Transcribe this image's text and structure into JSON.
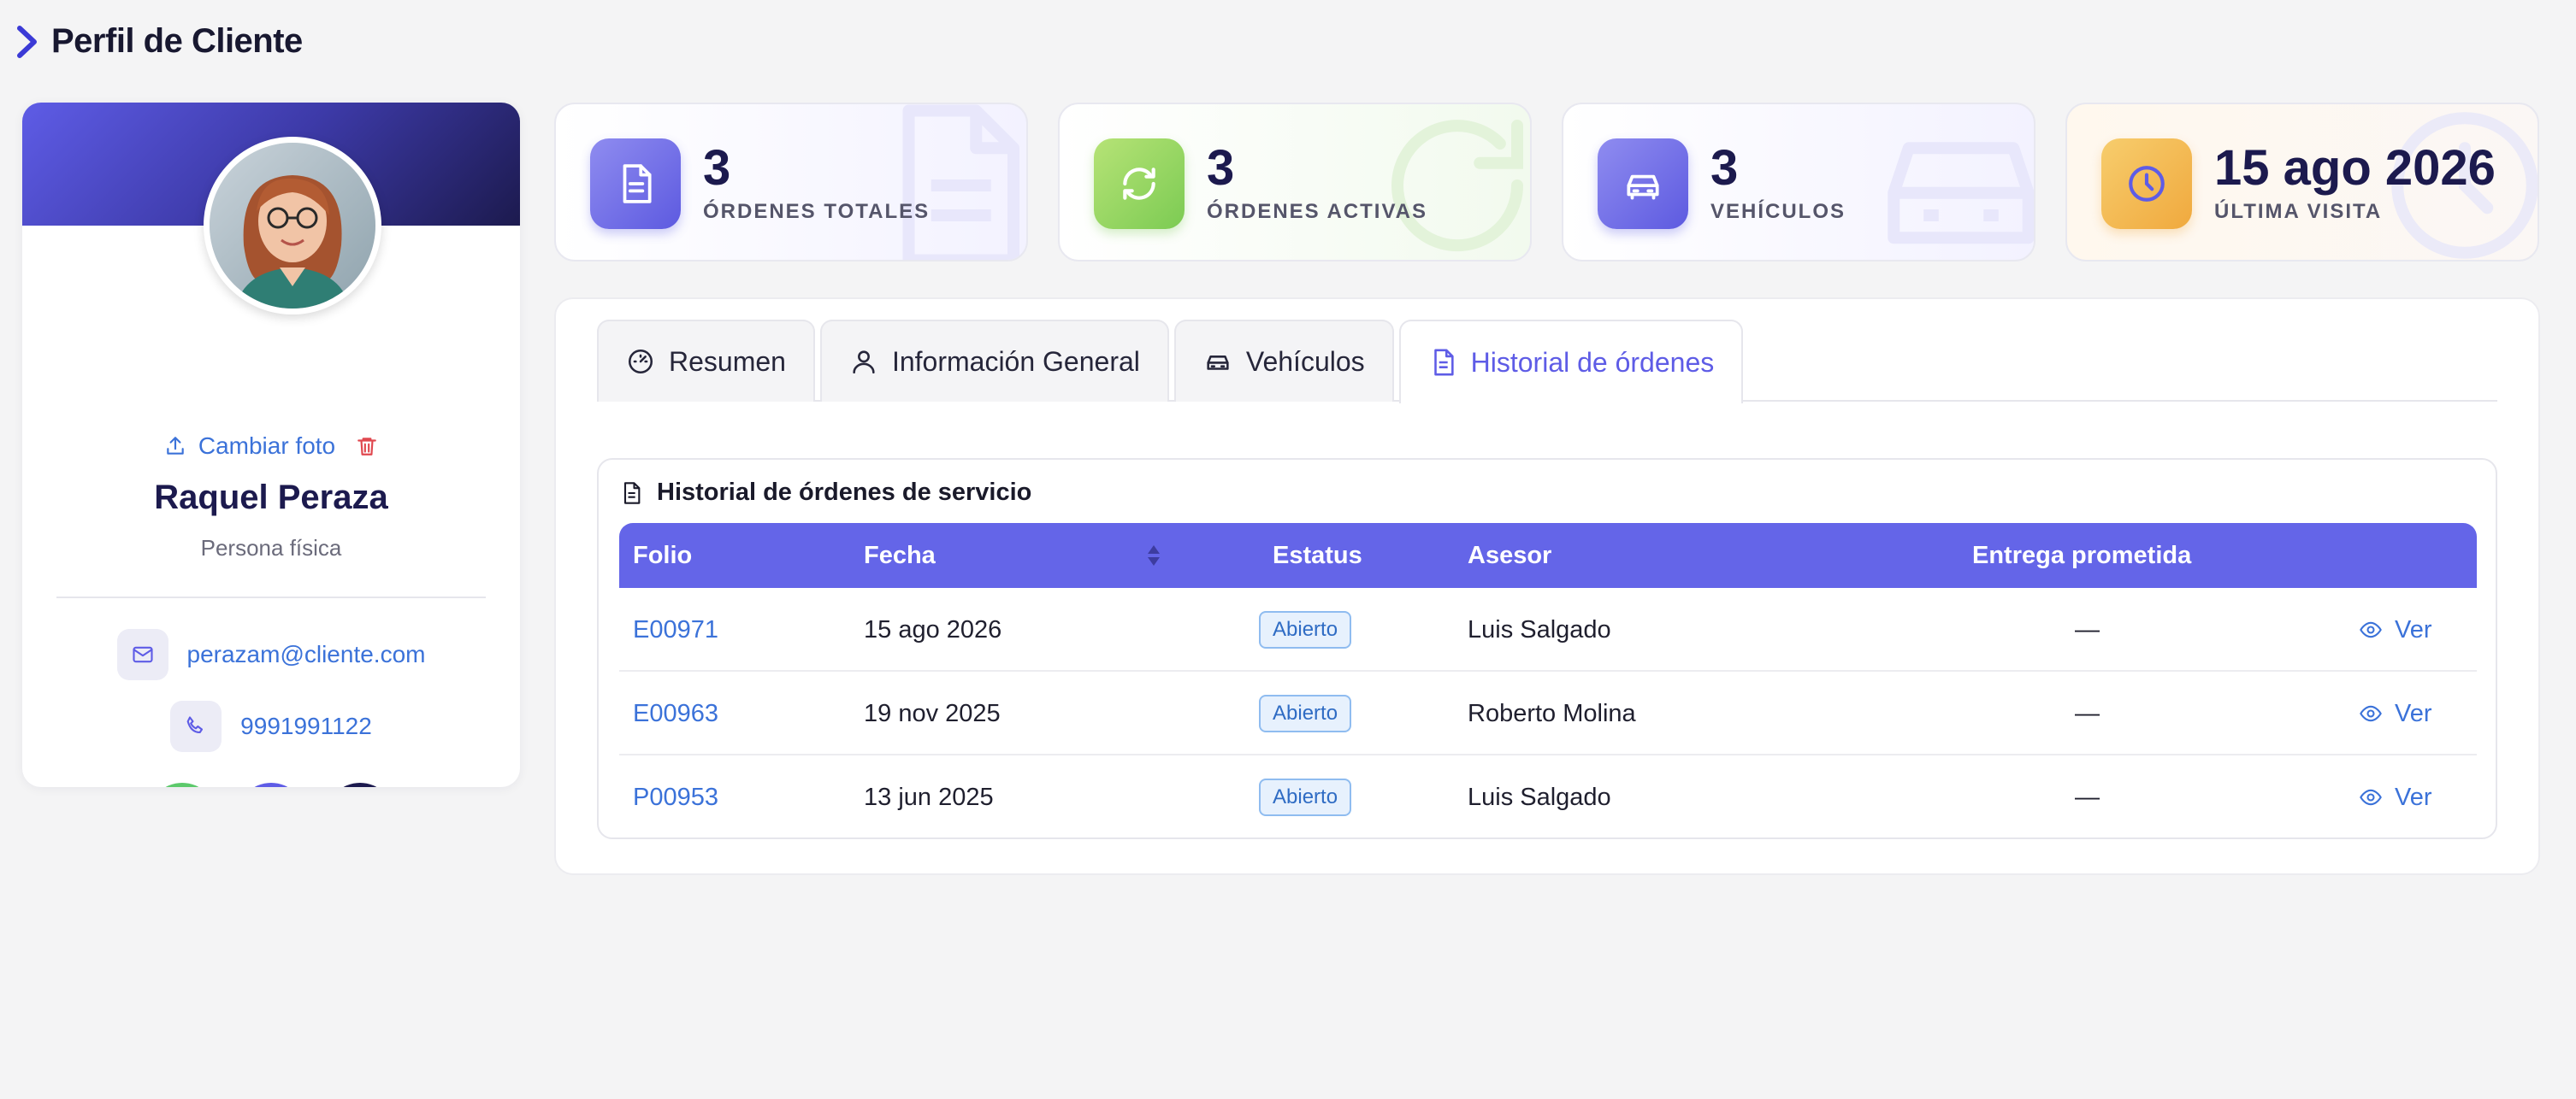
{
  "page": {
    "title": "Perfil de Cliente"
  },
  "profile": {
    "change_photo_label": "Cambiar foto",
    "name": "Raquel Peraza",
    "type": "Persona física",
    "email": "perazam@cliente.com",
    "phone": "9991991122"
  },
  "stats": [
    {
      "value": "3",
      "label": "ÓRDENES TOTALES",
      "icon": "document-icon",
      "color": "#5e5ce6"
    },
    {
      "value": "3",
      "label": "ÓRDENES ACTIVAS",
      "icon": "refresh-icon",
      "color": "#7ccb53"
    },
    {
      "value": "3",
      "label": "VEHÍCULOS",
      "icon": "car-icon",
      "color": "#5e5ce6"
    },
    {
      "value": "15 ago 2026",
      "label": "ÚLTIMA VISITA",
      "icon": "clock-icon",
      "color": "#f0a93e"
    }
  ],
  "tabs": [
    {
      "label": "Resumen",
      "icon": "speedometer-icon"
    },
    {
      "label": "Información General",
      "icon": "user-icon"
    },
    {
      "label": "Vehículos",
      "icon": "car-icon"
    },
    {
      "label": "Historial de órdenes",
      "icon": "document-icon",
      "active": true
    }
  ],
  "orders": {
    "title": "Historial de órdenes de servicio",
    "columns": [
      "Folio",
      "Fecha",
      "Estatus",
      "Asesor",
      "Entrega prometida"
    ],
    "rows": [
      {
        "folio": "E00971",
        "fecha": "15 ago 2026",
        "estatus": "Abierto",
        "asesor": "Luis Salgado",
        "entrega": "—",
        "action": "Ver"
      },
      {
        "folio": "E00963",
        "fecha": "19 nov 2025",
        "estatus": "Abierto",
        "asesor": "Roberto Molina",
        "entrega": "—",
        "action": "Ver"
      },
      {
        "folio": "P00953",
        "fecha": "13 jun 2025",
        "estatus": "Abierto",
        "asesor": "Luis Salgado",
        "entrega": "—",
        "action": "Ver"
      }
    ]
  },
  "colors": {
    "accent": "#5e5ce6",
    "link": "#3b72d9",
    "whatsapp": "#5cc96b",
    "navy": "#1c1a4e",
    "badge": "#2f6cc4"
  }
}
